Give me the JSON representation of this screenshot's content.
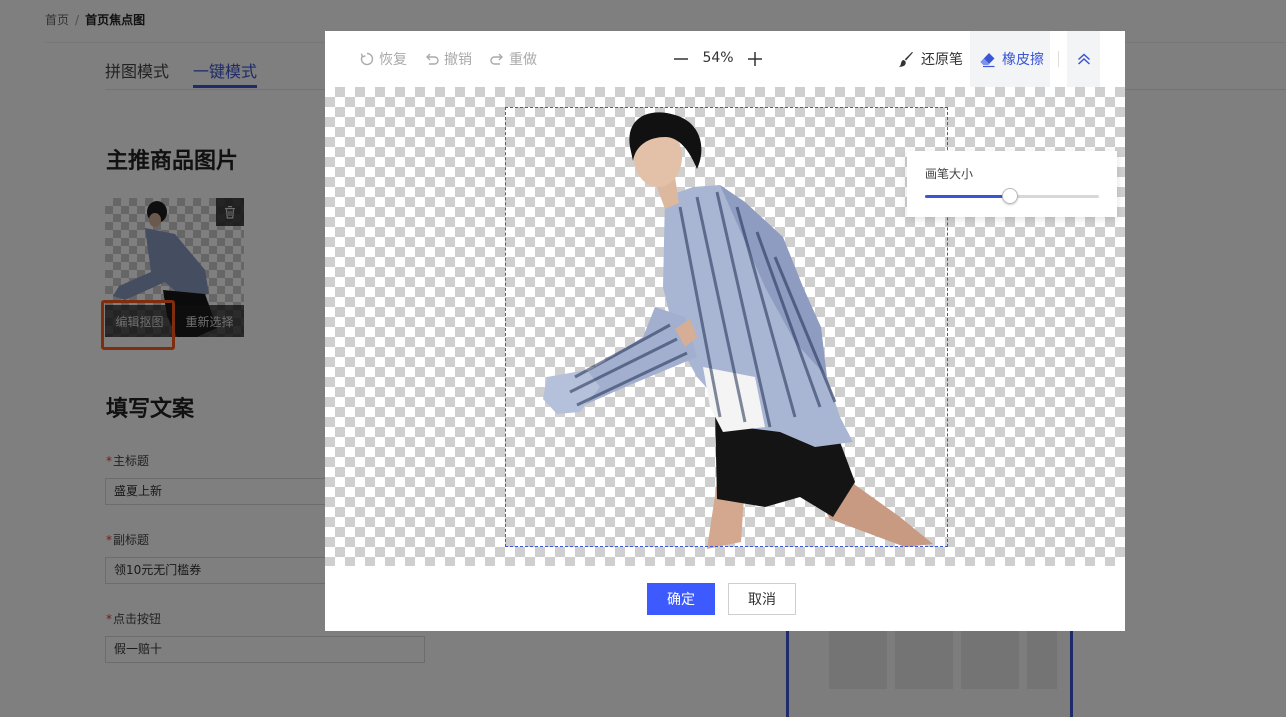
{
  "breadcrumb": {
    "home": "首页",
    "separator": "/",
    "current": "首页焦点图"
  },
  "modes": {
    "tab1": "拼图模式",
    "tab2": "一键模式",
    "active": "一键模式"
  },
  "product_section": {
    "title": "主推商品图片",
    "edit_label": "编辑抠图",
    "reselect_label": "重新选择"
  },
  "copy_section": {
    "title": "填写文案",
    "required_mark": "*",
    "main_title": {
      "label": "主标题",
      "value": "盛夏上新"
    },
    "subtitle": {
      "label": "副标题",
      "value": "领10元无门槛券"
    },
    "button": {
      "label": "点击按钮",
      "value": "假一赔十"
    }
  },
  "editor": {
    "restore_label": "恢复",
    "undo_label": "撤销",
    "redo_label": "重做",
    "zoom": "54%",
    "restore_brush_label": "还原笔",
    "eraser_label": "橡皮擦",
    "active_tool": "橡皮擦",
    "brush_size_label": "画笔大小",
    "brush_size_fraction": 0.49,
    "confirm_label": "确定",
    "cancel_label": "取消",
    "accent_color": "#3d5afe",
    "highlight_color": "#ff5a1f"
  },
  "icons": [
    "restore-icon",
    "undo-icon",
    "redo-icon",
    "zoom-out-icon",
    "zoom-in-icon",
    "brush-icon",
    "eraser-icon",
    "collapse-icon",
    "trash-icon"
  ]
}
